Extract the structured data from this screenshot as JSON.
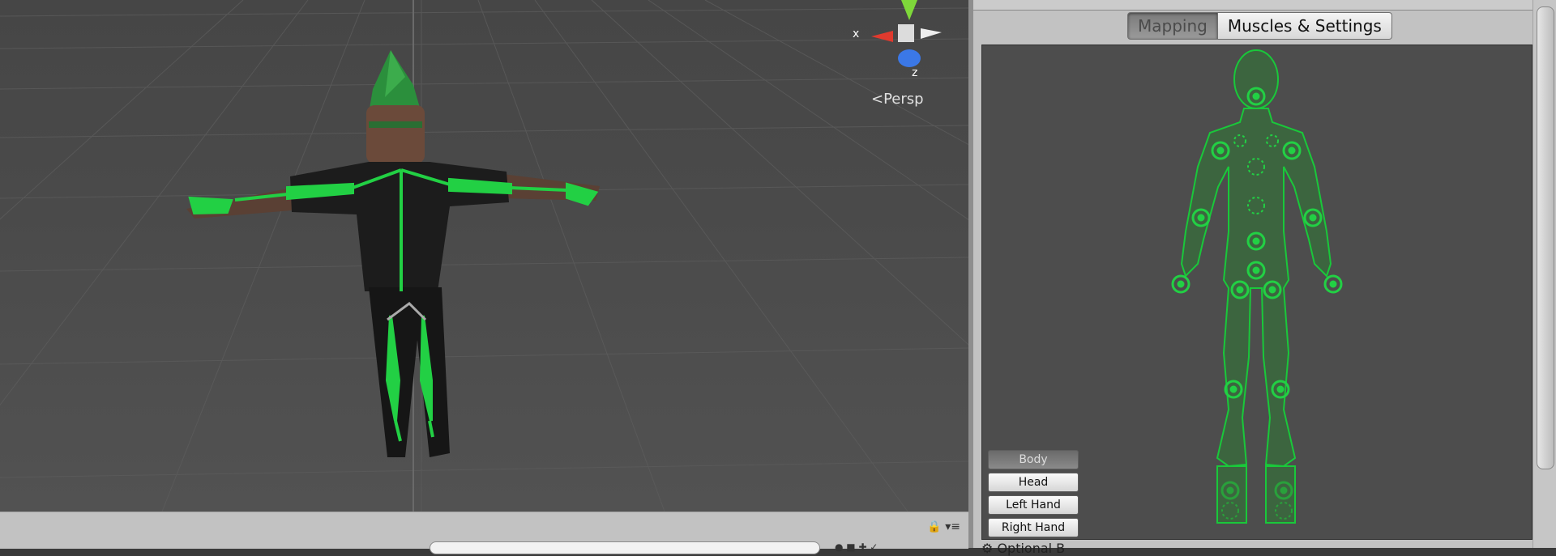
{
  "scene": {
    "gizmo": {
      "x_label": "x",
      "z_label": "z"
    },
    "projection_label": "Persp",
    "icons": [
      "lock-icon",
      "menu-icon",
      "search-icon"
    ]
  },
  "inspector": {
    "tabs": [
      {
        "label": "Mapping",
        "active": true
      },
      {
        "label": "Muscles & Settings",
        "active": false
      }
    ],
    "body_parts": [
      {
        "label": "Body",
        "selected": true
      },
      {
        "label": "Head",
        "selected": false
      },
      {
        "label": "Left Hand",
        "selected": false
      },
      {
        "label": "Right Hand",
        "selected": false
      }
    ],
    "optional_label": "Optional B"
  },
  "colors": {
    "bone_green": "#22d044",
    "avatar_outline": "#19c83a",
    "panel_bg": "#4d4d4d",
    "scene_bg": "#4a4a4a"
  }
}
